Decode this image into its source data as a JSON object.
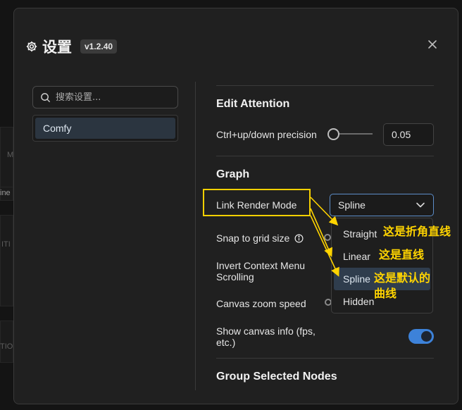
{
  "dialog": {
    "title": "设置",
    "version": "v1.2.40"
  },
  "search": {
    "placeholder": "搜索设置..."
  },
  "categories": [
    {
      "label": "Comfy",
      "selected": true
    }
  ],
  "sections": {
    "edit_attention": {
      "title": "Edit Attention",
      "precision_label": "Ctrl+up/down precision",
      "precision_value": "0.05"
    },
    "graph": {
      "title": "Graph",
      "link_render_mode_label": "Link Render Mode",
      "link_render_mode_value": "Spline",
      "snap_label": "Snap to grid size",
      "invert_label_line1": "Invert Context Menu",
      "invert_label_line2": "Scrolling",
      "zoom_label": "Canvas zoom speed",
      "canvas_info_label_line1": "Show canvas info (fps,",
      "canvas_info_label_line2": "etc.)",
      "canvas_info_enabled": true
    },
    "group_selected": {
      "title": "Group Selected Nodes"
    }
  },
  "dropdown_options": [
    "Straight",
    "Linear",
    "Spline",
    "Hidden"
  ],
  "annotations": {
    "straight": "这是折角直线",
    "linear": "这是直线",
    "spline_line1": "这是默认的",
    "spline_line2": "曲线"
  },
  "background": {
    "frag1": "M",
    "frag2": "ine",
    "frag3": "ITI",
    "frag4": "TIO"
  },
  "colors": {
    "accent": "#3d82d9",
    "annotation": "#ffd400"
  }
}
